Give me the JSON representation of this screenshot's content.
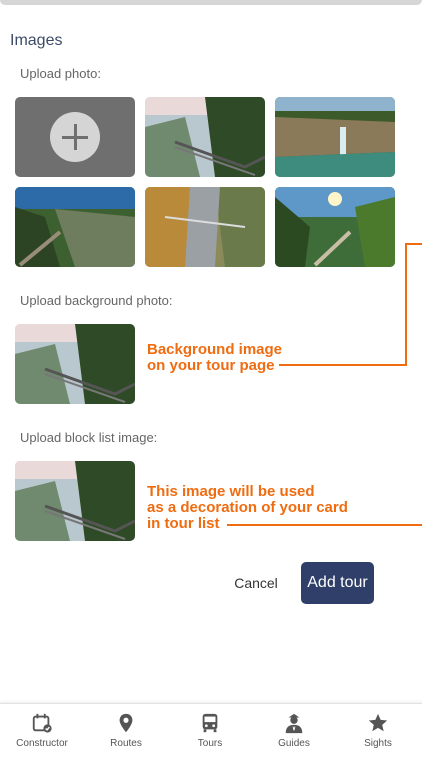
{
  "section": {
    "title": "Images"
  },
  "labels": {
    "upload_photo": "Upload photo:",
    "upload_background": "Upload background photo:",
    "upload_block": "Upload block list image:"
  },
  "annotations": {
    "background_line1": "Background image",
    "background_line2": "on your tour page",
    "block_line1": "This image will be used",
    "block_line2": "as a decoration of your card",
    "block_line3": "in tour list"
  },
  "buttons": {
    "cancel": "Cancel",
    "add_tour": "Add tour"
  },
  "nav": [
    {
      "label": "Constructor",
      "icon": "calendar-icon"
    },
    {
      "label": "Routes",
      "icon": "location-pin-icon"
    },
    {
      "label": "Tours",
      "icon": "bus-icon"
    },
    {
      "label": "Guides",
      "icon": "guide-icon"
    },
    {
      "label": "Sights",
      "icon": "star-icon"
    }
  ],
  "colors": {
    "accent": "#ef6c11",
    "primary": "#2f3f6a",
    "upload_tile": "#6f6f6f"
  }
}
